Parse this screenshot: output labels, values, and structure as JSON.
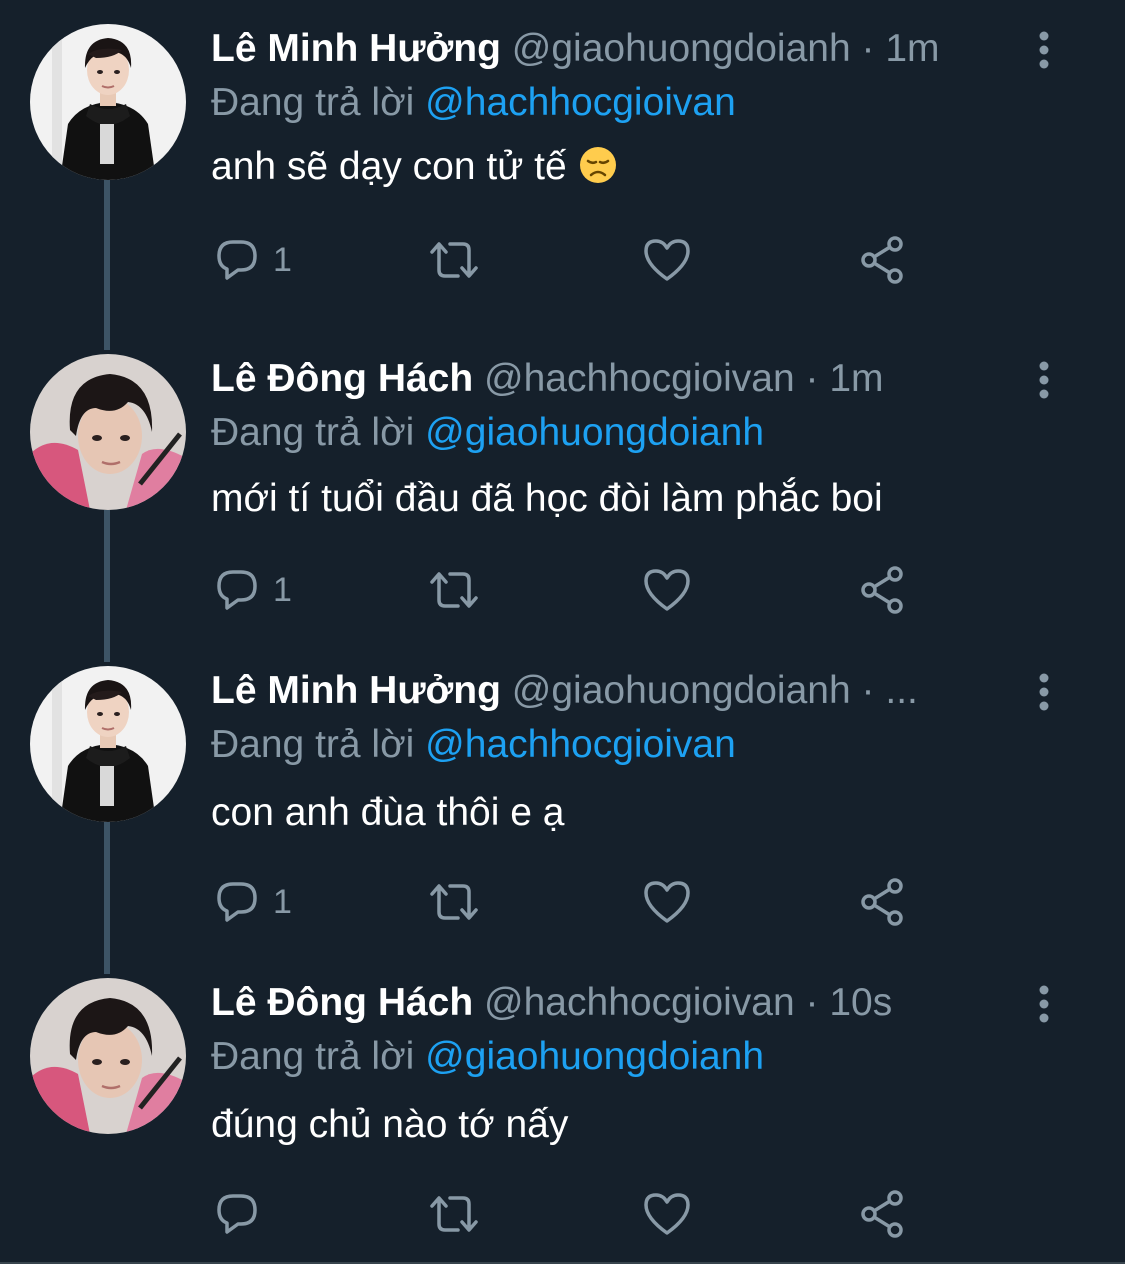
{
  "colors": {
    "background": "#15202b",
    "muted": "#8899a6",
    "mention": "#1da1f2",
    "thread_line": "#3d5466"
  },
  "tweets": [
    {
      "name": "Lê Minh Hưởng",
      "handle": "@giaohuongdoianh",
      "separator": "·",
      "time": "1m",
      "replying_prefix": "Đang trả lời",
      "replying_to": "@hachhocgioivan",
      "text": "anh sẽ dạy con tử tế",
      "emoji": "disappointed-face-emoji",
      "reply_count": "1",
      "avatar": "avatar-black-hoodie"
    },
    {
      "name": "Lê Đông Hách",
      "handle": "@hachhocgioivan",
      "separator": "·",
      "time": "1m",
      "replying_prefix": "Đang trả lời",
      "replying_to": "@giaohuongdoianh",
      "text": "mới tí tuổi đầu đã học đòi làm phắc boi",
      "reply_count": "1",
      "avatar": "avatar-pink-hoodie"
    },
    {
      "name": "Lê Minh Hưởng",
      "handle": "@giaohuongdoianh",
      "separator": "·",
      "time": "...",
      "replying_prefix": "Đang trả lời",
      "replying_to": "@hachhocgioivan",
      "text": "con anh đùa thôi e ạ",
      "reply_count": "1",
      "avatar": "avatar-black-hoodie"
    },
    {
      "name": "Lê Đông Hách",
      "handle": "@hachhocgioivan",
      "separator": "·",
      "time": "10s",
      "replying_prefix": "Đang trả lời",
      "replying_to": "@giaohuongdoianh",
      "text": "đúng chủ nào tớ nấy",
      "reply_count": "",
      "avatar": "avatar-pink-hoodie"
    }
  ]
}
